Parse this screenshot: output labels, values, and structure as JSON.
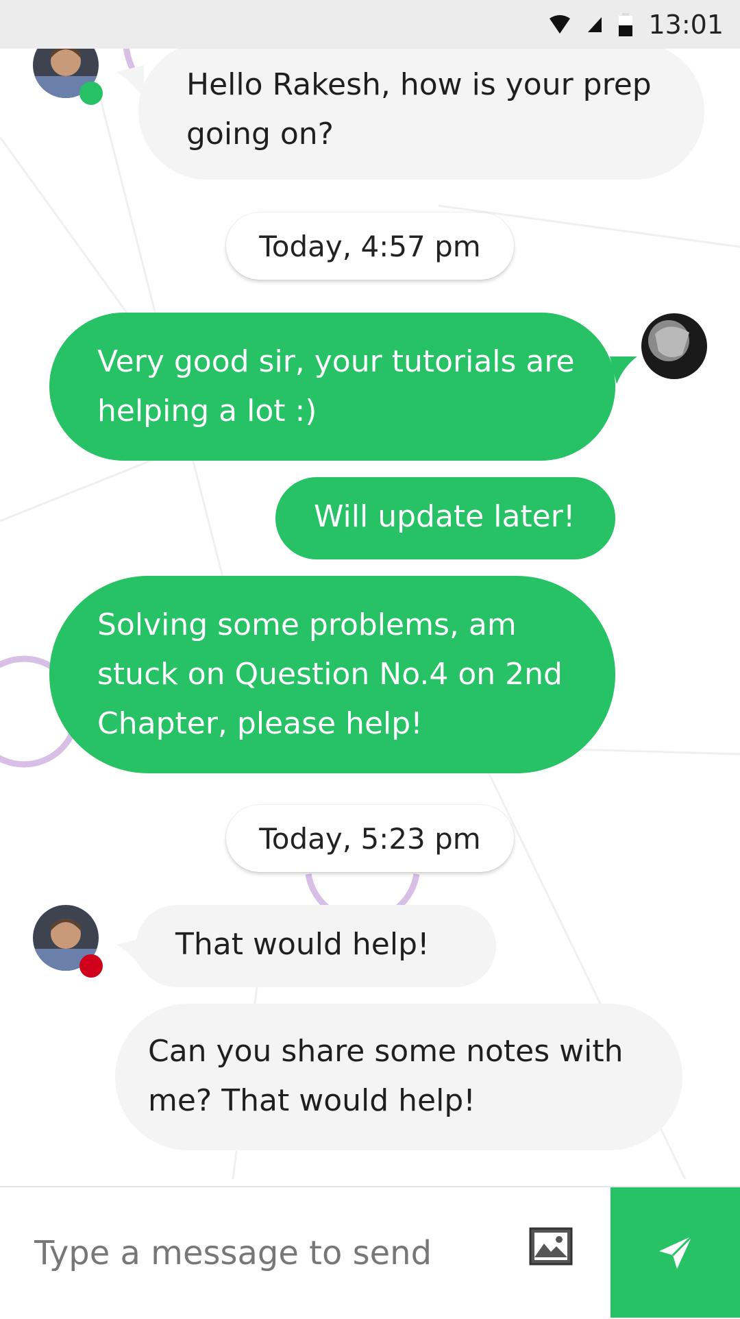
{
  "status_bar": {
    "time": "13:01"
  },
  "colors": {
    "accent": "#27c166",
    "incoming_bubble": "#f4f4f4",
    "online": "#27c166",
    "offline": "#d0021b"
  },
  "messages": [
    {
      "direction": "incoming",
      "text": "Hello Rakesh, how is your prep\ngoing on?",
      "avatar": "tutor-avatar",
      "status": "online"
    },
    {
      "type": "timestamp",
      "text": "Today, 4:57 pm"
    },
    {
      "direction": "outgoing",
      "text": "Very good sir, your tutorials are\nhelping a lot :)",
      "avatar": "student-avatar"
    },
    {
      "direction": "outgoing",
      "text": "Will update later!"
    },
    {
      "direction": "outgoing",
      "text": "Solving some problems, am\nstuck on Question No.4 on 2nd\nChapter, please help!"
    },
    {
      "type": "timestamp",
      "text": "Today, 5:23 pm"
    },
    {
      "direction": "incoming",
      "text": "That would help!",
      "avatar": "tutor-avatar",
      "status": "offline"
    },
    {
      "direction": "incoming",
      "text": "Can you share some notes with\nme? That would help!"
    }
  ],
  "composer": {
    "placeholder": "Type a message to send",
    "gallery_icon": "image-icon",
    "send_icon": "send-icon"
  }
}
